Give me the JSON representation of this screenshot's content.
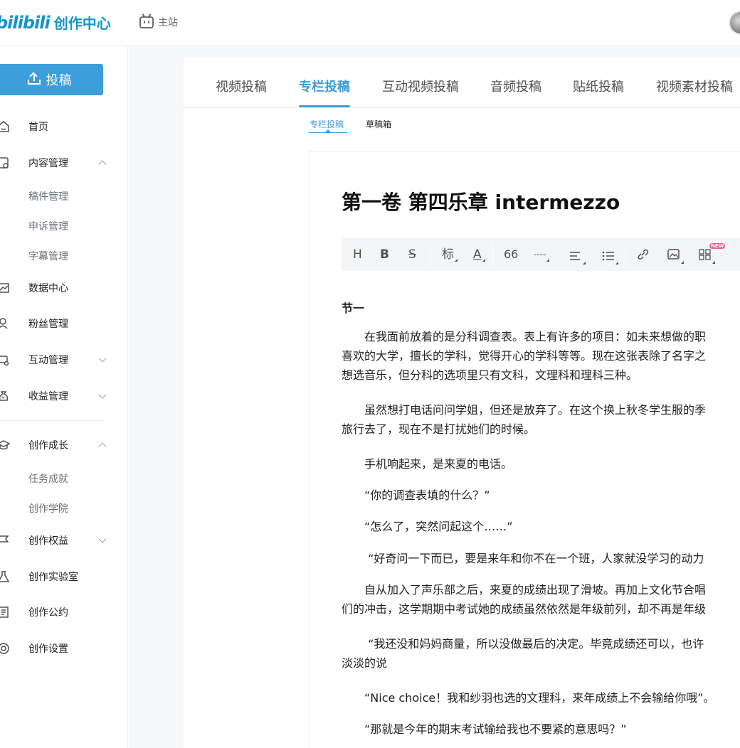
{
  "header": {
    "logo_mark": "bilibili",
    "logo_text": "创作中心",
    "main_site": "主站"
  },
  "sidebar": {
    "upload_label": "投稿",
    "items": [
      {
        "label": "首页",
        "icon": "home-icon"
      },
      {
        "label": "内容管理",
        "icon": "content-icon",
        "expanded": true,
        "children": [
          "稿件管理",
          "申诉管理",
          "字幕管理"
        ]
      },
      {
        "label": "数据中心",
        "icon": "chart-icon"
      },
      {
        "label": "粉丝管理",
        "icon": "fans-icon"
      },
      {
        "label": "互动管理",
        "icon": "interact-icon",
        "expanded": false
      },
      {
        "label": "收益管理",
        "icon": "money-icon",
        "expanded": false
      },
      {
        "label": "创作成长",
        "icon": "growth-icon",
        "expanded": true,
        "children": [
          "任务成就",
          "创作学院"
        ]
      },
      {
        "label": "创作权益",
        "icon": "flag-icon",
        "expanded": false
      },
      {
        "label": "创作实验室",
        "icon": "lab-icon"
      },
      {
        "label": "创作公约",
        "icon": "document-icon"
      },
      {
        "label": "创作设置",
        "icon": "settings-icon"
      }
    ]
  },
  "tabs": [
    "视频投稿",
    "专栏投稿",
    "互动视频投稿",
    "音频投稿",
    "贴纸投稿",
    "视频素材投稿"
  ],
  "active_tab": "专栏投稿",
  "subtabs": [
    "专栏投稿",
    "草稿箱"
  ],
  "editor": {
    "title": "第一卷 第四乐章 intermezzo",
    "toolbar": {
      "heading": "H",
      "bold": "B",
      "strike": "S",
      "mark": "标",
      "color": "A",
      "quote": "66",
      "divider": "----",
      "new_badge": "NEW"
    },
    "section": "节一",
    "paragraphs": [
      "　　在我面前放着的是分科调查表。表上有许多的项目：如未来想做的职",
      "喜欢的大学，擅长的学科，觉得开心的学科等等。现在这张表除了名字之",
      "想选音乐，但分科的选项里只有文科，文理科和理科三种。",
      "　　虽然想打电话问问学姐，但还是放弃了。在这个换上秋冬学生服的季",
      "旅行去了，现在不是打扰她们的时候。",
      "　　手机响起来，是来夏的电话。",
      "　　“你的调查表填的什么？”",
      "　　“怎么了，突然问起这个……”",
      "　　 “好奇问一下而已，要是来年和你不在一个班，人家就没学习的动力",
      "　　自从加入了声乐部之后，来夏的成绩出现了滑坡。再加上文化节合唱",
      "们的冲击，这学期期中考试她的成绩虽然依然是年级前列，却不再是年级",
      "　　 “我还没和妈妈商量，所以没做最后的决定。毕竟成绩还可以，也许",
      "淡淡的说",
      "　　“Nice choice！我和纱羽也选的文理科，来年成绩上不会输给你哦”。",
      "　　“那就是今年的期末考试输给我也不要紧的意思吗？”"
    ]
  }
}
